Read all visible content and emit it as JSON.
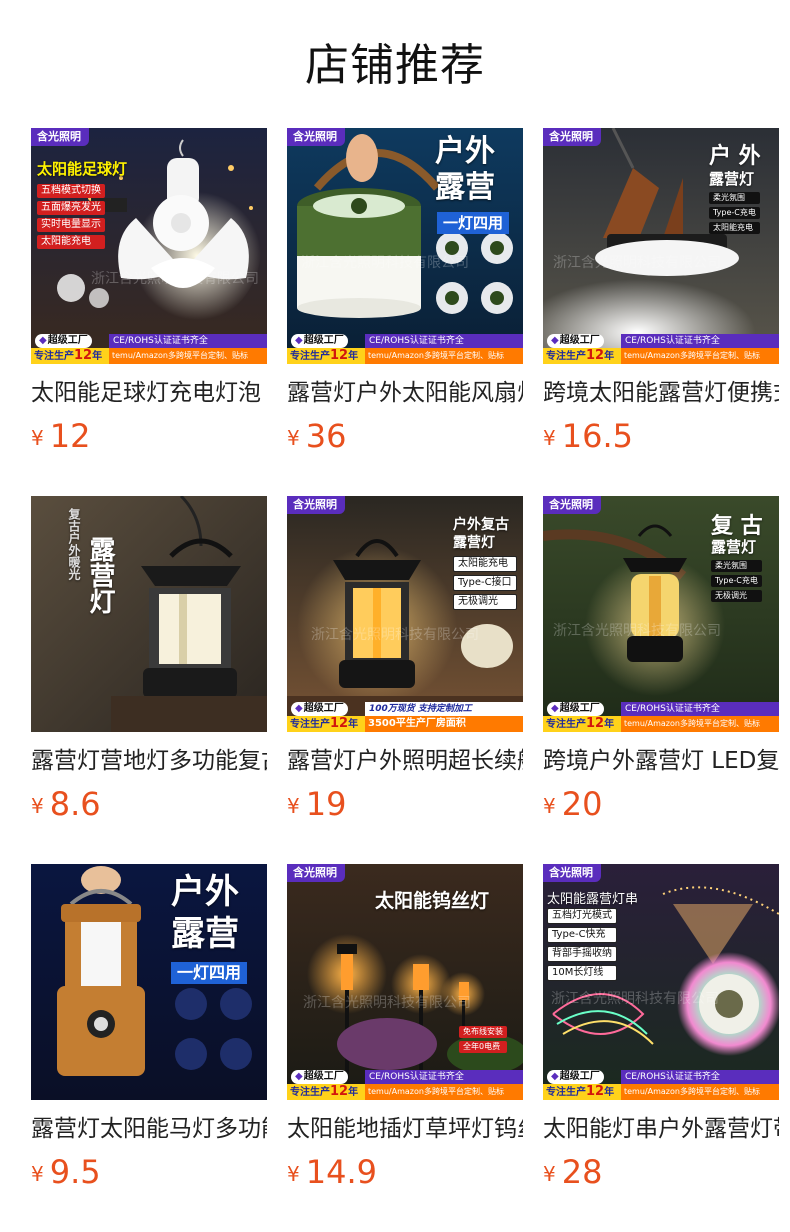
{
  "page": {
    "title": "店铺推荐"
  },
  "currency": "¥",
  "common": {
    "brand": "含光照明",
    "factory": "超级工厂",
    "cert": "CE/ROHS认证证书齐全",
    "years_prefix": "专注生产",
    "years_num": "12",
    "years_suffix": "年",
    "amazon": "temu/Amazon多跨境平台定制、贴标",
    "watermark": "浙江含光照明科技有限公司"
  },
  "products": [
    {
      "name": "太阳能足球灯充电灯泡",
      "price": "12",
      "image": {
        "headline": "太阳能足球灯",
        "features": [
          "五档模式切换",
          "五面爆亮发光",
          "实时电量显示",
          "太阳能充电"
        ]
      }
    },
    {
      "name": "露营灯户外太阳能风扇灯",
      "price": "36",
      "image": {
        "headline": "户外",
        "headline2": "露营",
        "badge": "一灯四用",
        "icons": [
          "营地灯模式",
          "手提模式",
          "风扇模式",
          "充电宝模式"
        ]
      }
    },
    {
      "name": "跨境太阳能露营灯便携式",
      "price": "16.5",
      "image": {
        "headline": "户 外",
        "headline2": "露营灯",
        "features": [
          "柔光氛围",
          "Type-C充电",
          "太阳能充电"
        ]
      }
    },
    {
      "name": "露营灯营地灯多功能复古",
      "price": "8.6",
      "image": {
        "vertical_small": "复古户外暖光",
        "vertical_big": "露营灯"
      }
    },
    {
      "name": "露营灯户外照明超长续航",
      "price": "19",
      "image": {
        "headline": "户外复古",
        "headline2": "露营灯",
        "features": [
          "太阳能充电",
          "Type-C接口",
          "无极调光"
        ],
        "stock": "100万现货 支持定制加工",
        "area": "3500平生产厂房面积"
      }
    },
    {
      "name": "跨境户外露营灯 LED复古",
      "price": "20",
      "image": {
        "headline": "复 古",
        "headline2": "露营灯",
        "features": [
          "柔光氛围",
          "Type-C充电",
          "无极调光"
        ]
      }
    },
    {
      "name": "露营灯太阳能马灯多功能",
      "price": "9.5",
      "image": {
        "headline": "户外",
        "headline2": "露营",
        "badge": "一灯四用",
        "icons": [
          "营地灯模式",
          "手提模式",
          "投照模式",
          "充电宝模式"
        ]
      }
    },
    {
      "name": "太阳能地插灯草坪灯钨丝灯",
      "price": "14.9",
      "image": {
        "headline": "太阳能钨丝灯",
        "features": [
          "免布线安装",
          "全年0电费"
        ]
      }
    },
    {
      "name": "太阳能灯串户外露营灯带",
      "price": "28",
      "image": {
        "headline": "太阳能露营灯串",
        "features": [
          "五档灯光模式",
          "Type-C快充",
          "背部手摇收纳",
          "10M长灯线"
        ]
      }
    }
  ],
  "colors": {
    "price": "#e8501e",
    "brand_purple": "#5a2dbd",
    "accent_yellow": "#ffd21a",
    "accent_orange": "#ff7a00"
  }
}
